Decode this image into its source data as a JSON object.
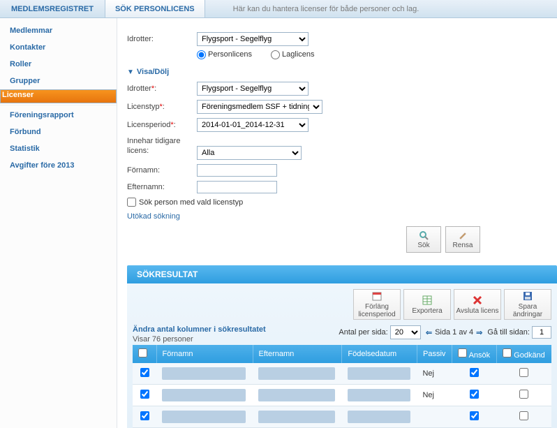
{
  "topbar": {
    "tab1": "MEDLEMSREGISTRET",
    "tab2": "SÖK PERSONLICENS",
    "desc": "Här kan du hantera licenser för både personer och lag."
  },
  "sidebar": {
    "groups": [
      [
        "Medlemmar",
        "Kontakter",
        "Roller",
        "Grupper",
        "Licenser"
      ],
      [
        "Föreningsrapport",
        "Förbund",
        "Statistik",
        "Avgifter före 2013"
      ]
    ],
    "selected": "Licenser"
  },
  "form": {
    "labels": {
      "idrotter": "Idrotter:",
      "personlicens": "Personlicens",
      "laglicens": "Laglicens",
      "visa": "Visa/Dölj",
      "idrotter2": "Idrotter*:",
      "licenstyp": "Licenstyp*:",
      "licensperiod": "Licensperiod*:",
      "innehar": "Innehar tidigare licens:",
      "fornamn": "Förnamn:",
      "efternamn": "Efternamn:",
      "sokvaldcheck": "Sök person med vald licenstyp",
      "utokad": "Utökad sökning"
    },
    "values": {
      "idrotter": "Flygsport - Segelflyg",
      "idrotter2": "Flygsport - Segelflyg",
      "licenstyp": "Föreningsmedlem SSF + tidning",
      "licensperiod": "2014-01-01_2014-12-31",
      "innehar": "Alla",
      "fornamn": "",
      "efternamn": ""
    },
    "buttons": {
      "sok": "Sök",
      "rensa": "Rensa"
    }
  },
  "results": {
    "title": "SÖKRESULTAT",
    "actions": {
      "forlang": "Förläng licensperiod",
      "exportera": "Exportera",
      "avsluta": "Avsluta licens",
      "spara": "Spara ändringar"
    },
    "change_cols": "Ändra antal kolumner i sökresultatet",
    "count": "Visar 76 personer",
    "pager": {
      "antal": "Antal per sida:",
      "per_page": "20",
      "sida": "Sida 1 av 4",
      "goto": "Gå till sidan:",
      "page": "1"
    },
    "columns": {
      "fornamn": "Förnamn",
      "efternamn": "Efternamn",
      "fodelse": "Födelsedatum",
      "passiv": "Passiv",
      "ansok": "Ansök",
      "godkand": "Godkänd"
    },
    "rows": [
      {
        "passiv": "Nej",
        "ansok": true,
        "godkand": false,
        "sel": true
      },
      {
        "passiv": "Nej",
        "ansok": true,
        "godkand": false,
        "sel": true
      },
      {
        "passiv": "",
        "ansok": true,
        "godkand": false,
        "sel": true
      }
    ]
  }
}
